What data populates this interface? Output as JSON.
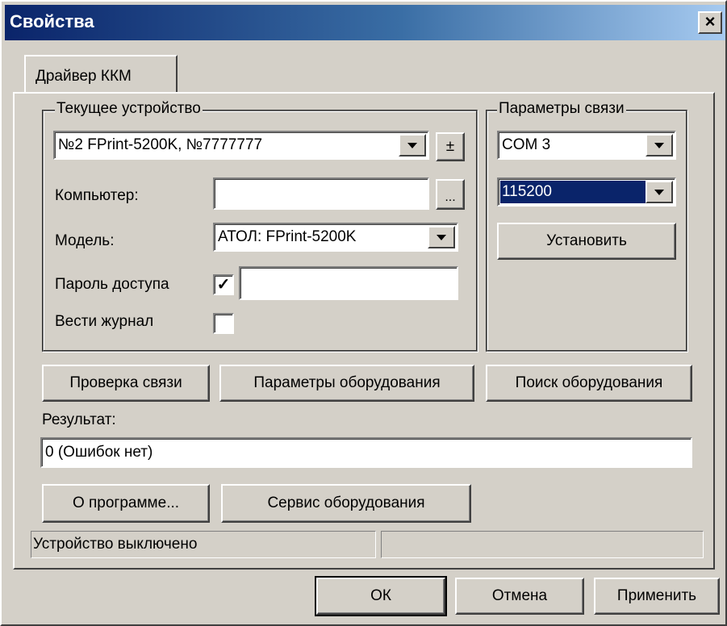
{
  "window": {
    "title": "Свойства",
    "close_glyph": "×"
  },
  "tabs": [
    {
      "label": "Драйвер ККМ"
    }
  ],
  "current_device": {
    "legend": "Текущее устройство",
    "device_value": "№2 FPrint-5200K, №7777777",
    "plusminus_label": "±",
    "computer_label": "Компьютер:",
    "computer_value": "",
    "browse_label": "...",
    "model_label": "Модель:",
    "model_value": "АТОЛ: FPrint-5200K",
    "password_label": "Пароль доступа",
    "password_checked": "✓",
    "password_value": "",
    "log_label": "Вести журнал"
  },
  "connection": {
    "legend": "Параметры связи",
    "port_value": "COM 3",
    "baud_value": "115200",
    "set_label": "Установить"
  },
  "actions": {
    "check_label": "Проверка связи",
    "params_label": "Параметры оборудования",
    "search_label": "Поиск оборудования"
  },
  "result": {
    "label": "Результат:",
    "value": "0 (Ошибок нет)"
  },
  "bottom": {
    "about_label": "О программе...",
    "service_label": "Сервис оборудования"
  },
  "status": {
    "left": "Устройство выключено",
    "right": ""
  },
  "dialog": {
    "ok_label": "ОК",
    "cancel_label": "Отмена",
    "apply_label": "Применить"
  }
}
